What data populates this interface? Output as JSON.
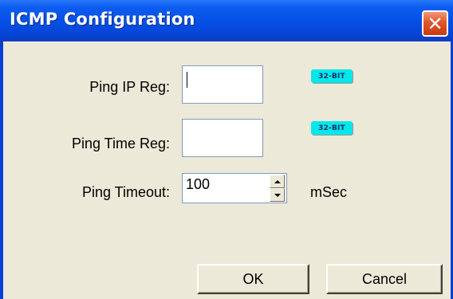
{
  "window": {
    "title": "ICMP Configuration",
    "close_glyph": "✕"
  },
  "fields": {
    "ping_ip_reg": {
      "label": "Ping IP Reg:",
      "value": "",
      "badge": "32-BIT"
    },
    "ping_time_reg": {
      "label": "Ping Time Reg:",
      "value": "",
      "badge": "32-BIT"
    },
    "ping_timeout": {
      "label": "Ping Timeout:",
      "value": "100",
      "unit": "mSec"
    }
  },
  "buttons": {
    "ok": "OK",
    "cancel": "Cancel"
  },
  "icons": {
    "close": "close-icon",
    "spin_up": "chevron-up-icon",
    "spin_down": "chevron-down-icon"
  },
  "colors": {
    "titlebar": "#0650e6",
    "face": "#ece9d8",
    "badge": "#00e8ea",
    "close": "#e2552a"
  }
}
